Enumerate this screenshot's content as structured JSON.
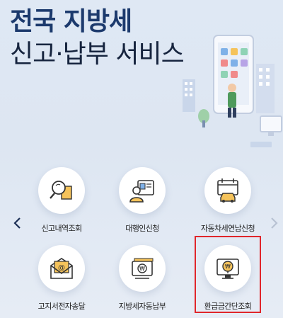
{
  "hero": {
    "title_line1": "전국 지방세",
    "title_line2": "신고·납부 서비스"
  },
  "nav": {
    "prev_icon": "chevron-left-icon",
    "next_icon": "chevron-right-icon"
  },
  "services": [
    {
      "label": "신고내역조회",
      "icon": "search-document-icon"
    },
    {
      "label": "대행인신청",
      "icon": "agent-id-card-icon"
    },
    {
      "label": "자동차세연납신청",
      "icon": "car-calendar-icon"
    },
    {
      "label": "고지서전자송달",
      "icon": "email-envelope-icon"
    },
    {
      "label": "지방세자동납부",
      "icon": "auto-payment-icon"
    },
    {
      "label": "환급금간단조회",
      "icon": "refund-monitor-icon"
    }
  ],
  "highlighted_service": "환급금간단조회",
  "colors": {
    "title_primary": "#1c3a6d",
    "title_secondary": "#16243e",
    "highlight_border": "#e0262b",
    "icon_stroke": "#333333"
  }
}
